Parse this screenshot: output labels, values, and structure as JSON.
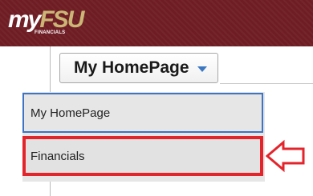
{
  "header": {
    "logo": {
      "my": "my",
      "fsu": "FSU",
      "sub": "FINANCIALS"
    },
    "background": "#6f1d24"
  },
  "homepage_button": {
    "label": "My HomePage",
    "icon": "chevron-down-icon"
  },
  "dropdown": {
    "options": [
      {
        "label": "My HomePage",
        "highlight": "focus",
        "highlight_color": "#3e74c4"
      },
      {
        "label": "Financials",
        "highlight": "callout",
        "highlight_color": "#e3242b"
      }
    ]
  },
  "annotation": {
    "icon": "left-arrow-icon",
    "color": "#e3242b"
  }
}
